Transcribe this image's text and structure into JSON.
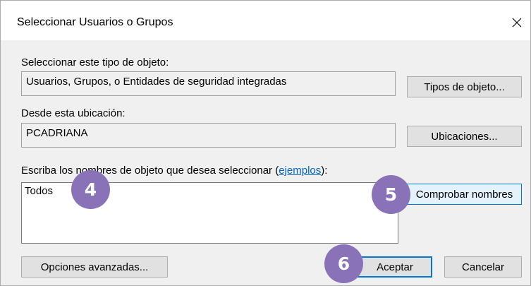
{
  "dialog": {
    "title": "Seleccionar Usuarios o Grupos"
  },
  "object_type": {
    "label": "Seleccionar este tipo de objeto:",
    "value": "Usuarios, Grupos, o Entidades de seguridad integradas",
    "button": "Tipos de objeto..."
  },
  "location": {
    "label": "Desde esta ubicación:",
    "value": "PCADRIANA",
    "button": "Ubicaciones..."
  },
  "names": {
    "label_prefix": "Escriba los nombres de objeto que desea seleccionar (",
    "link": "ejemplos",
    "label_suffix": "):",
    "value": "Todos",
    "check_button": "Comprobar nombres"
  },
  "footer": {
    "advanced_button": "Opciones avanzadas...",
    "ok_button": "Aceptar",
    "cancel_button": "Cancelar"
  },
  "badges": [
    "4",
    "5",
    "6"
  ],
  "colors": {
    "accent": "#0078d7",
    "badge": "#8a72b9"
  }
}
